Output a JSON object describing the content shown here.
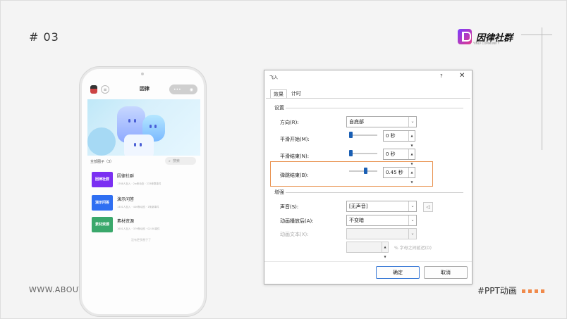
{
  "slide": {
    "page_number": "# 03",
    "website": "WWW.ABOUTP",
    "hashtag": "#PPT动画",
    "logo_text": "因律社群",
    "logo_sub": "YINLV COMMUNITY"
  },
  "phone": {
    "app_title": "因律",
    "capsule_dots": "•••",
    "circle_header": "全部圈子（3）",
    "search_placeholder": "搜索",
    "groups": [
      {
        "name": "因律社群",
        "thumb": "因律社群",
        "color": "#7b2ff2",
        "meta": "1768人加入 · 2w条动态 · 233种群事件"
      },
      {
        "name": "演示问答",
        "thumb": "演示问答",
        "color": "#2f6ff2",
        "meta": "1401人加入 · 446条动态 · 1条新事件"
      },
      {
        "name": "素材资源",
        "thumb": "素材资源",
        "color": "#3aa86b",
        "meta": "1601人加入 · 379条动态 · 02:30事件"
      }
    ],
    "more_text": "没有更多圈子了"
  },
  "dialog": {
    "title": "飞入",
    "help": "?",
    "close": "✕",
    "tabs": [
      "效果",
      "计时"
    ],
    "section_settings": "设置",
    "direction_label": "方向(R):",
    "direction_value": "自底部",
    "smooth_start_label": "平滑开始(M):",
    "smooth_start_value": "0 秒",
    "smooth_end_label": "平滑结束(N):",
    "smooth_end_value": "0 秒",
    "bounce_end_label": "弹跳结束(B):",
    "bounce_end_value": "0.45 秒",
    "section_enhance": "增强",
    "sound_label": "声音(S):",
    "sound_value": "[无声音]",
    "after_anim_label": "动画播放后(A):",
    "after_anim_value": "不变暗",
    "anim_text_label": "动画文本(X):",
    "anim_text_value": "",
    "pct_label": "% 字母之间延迟(D)",
    "ok": "确定",
    "cancel": "取消"
  }
}
